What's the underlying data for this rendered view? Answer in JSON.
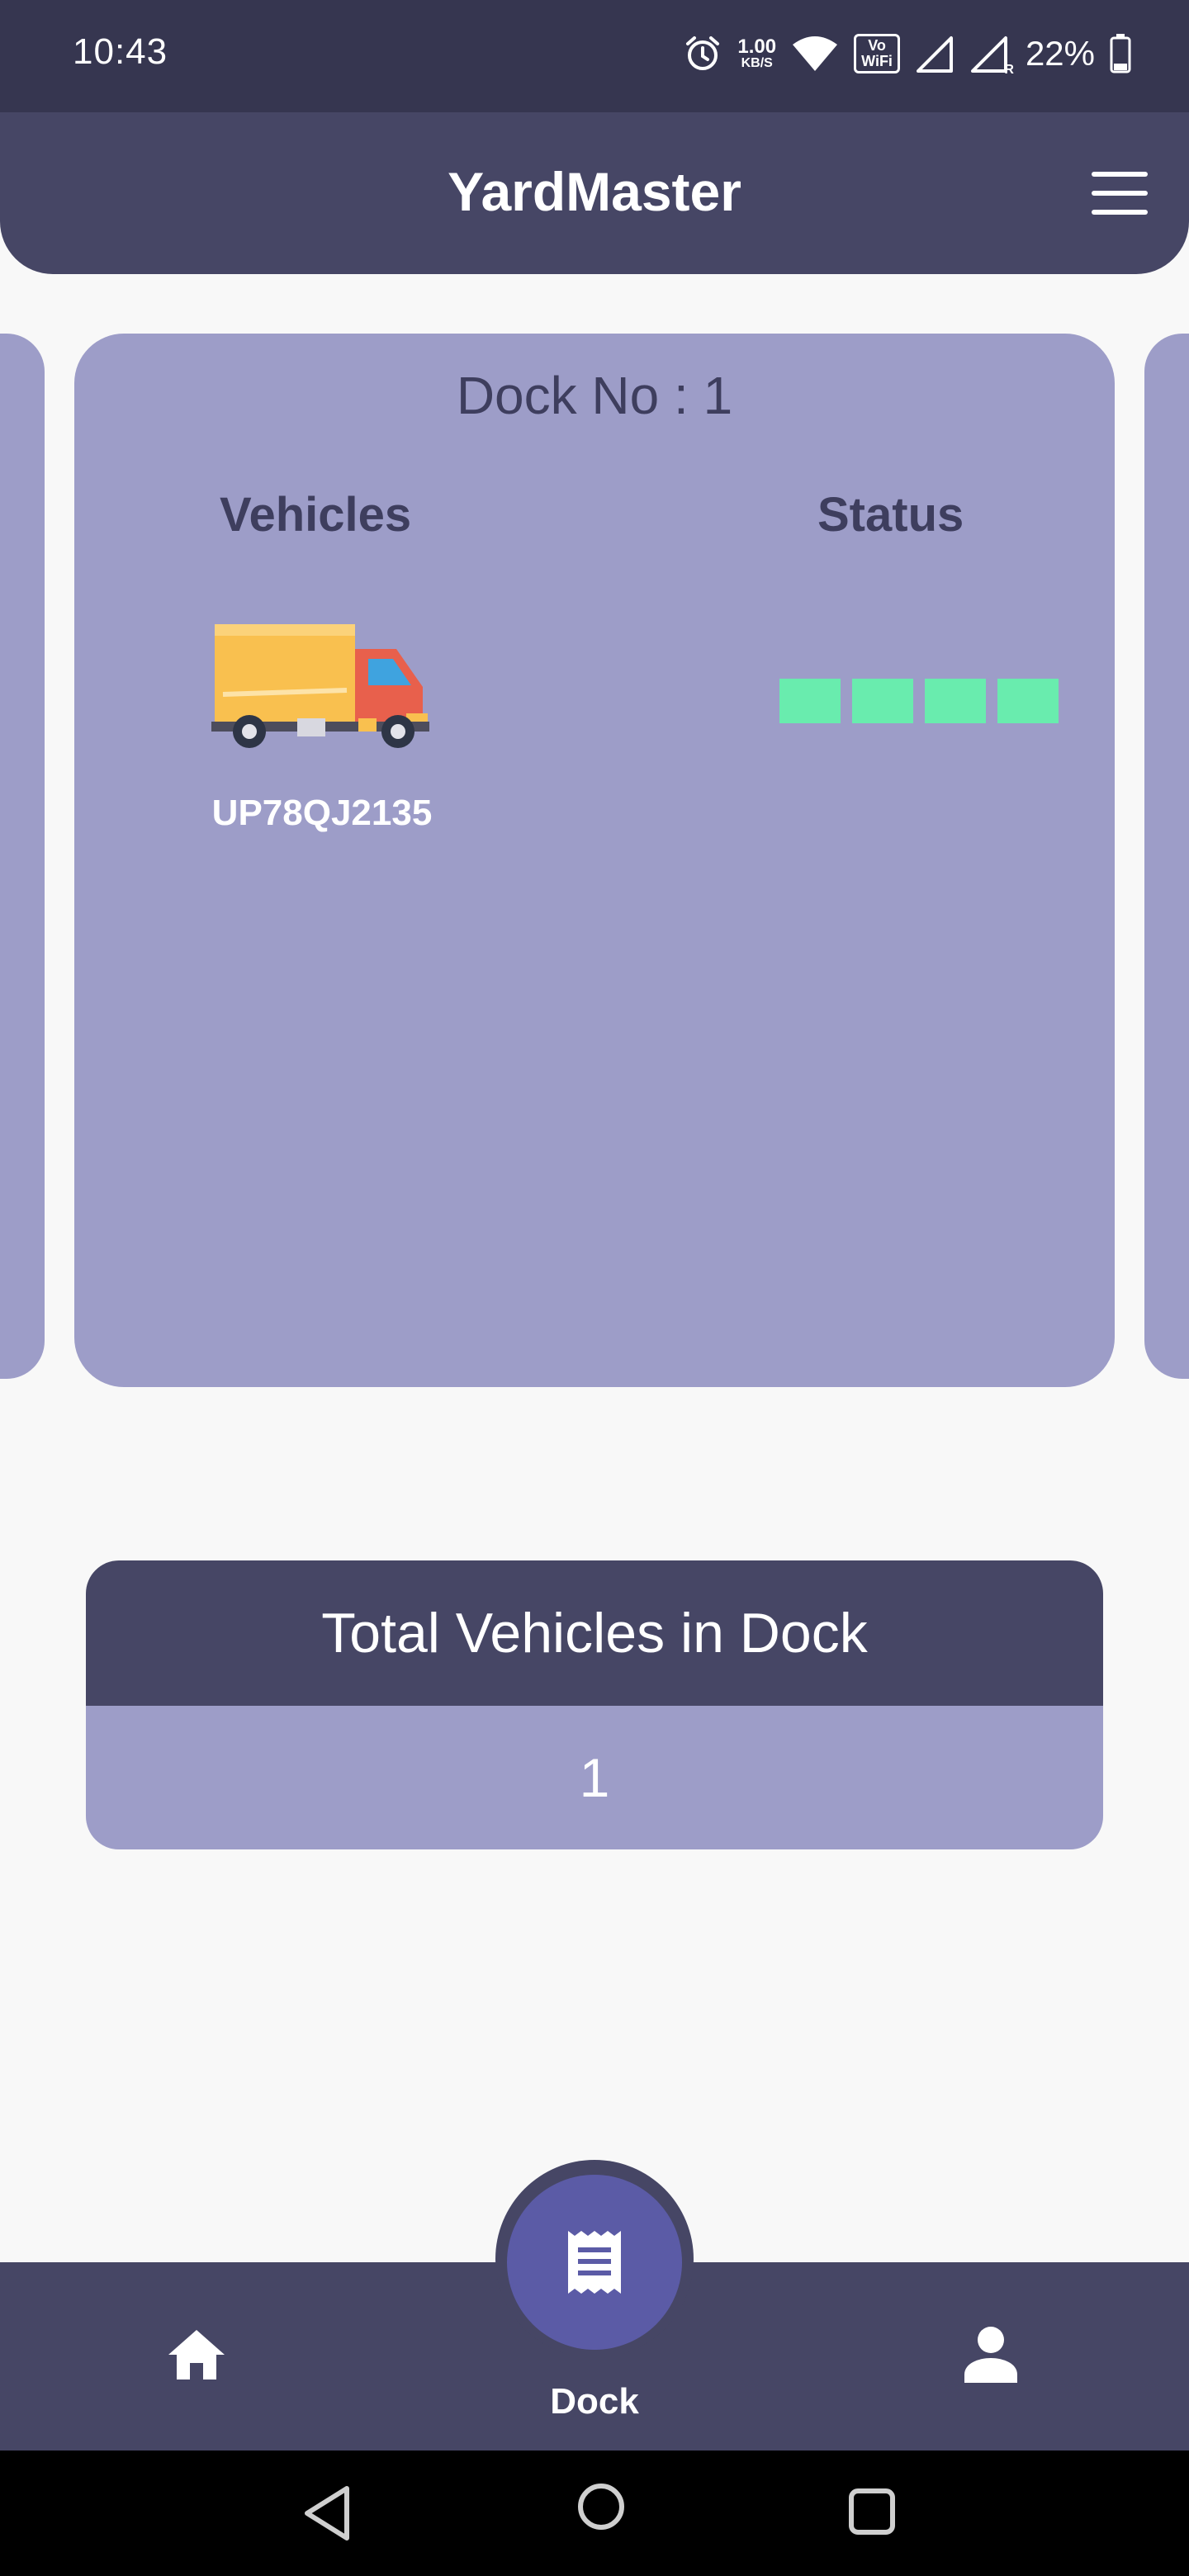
{
  "status_bar": {
    "time": "10:43",
    "net_speed_value": "1.00",
    "net_speed_unit": "KB/S",
    "volte_line1": "Vo",
    "volte_line2": "WiFi",
    "sim2_label": "R",
    "battery_percent": "22%",
    "icons": [
      "alarm-icon",
      "wifi-icon",
      "volte-wifi-icon",
      "signal-icon",
      "signal-roaming-icon",
      "battery-icon"
    ]
  },
  "app_bar": {
    "title": "YardMaster",
    "menu_icon": "hamburger-menu-icon"
  },
  "dock": {
    "title": "Dock No : 1",
    "vehicles_header": "Vehicles",
    "status_header": "Status",
    "vehicles": [
      {
        "icon": "truck-icon",
        "plate": "UP78QJ2135"
      }
    ],
    "status_segments_filled": 4,
    "status_segments_total": 4,
    "status_color": "#69ecae"
  },
  "total": {
    "label": "Total Vehicles in Dock",
    "value": "1"
  },
  "bottom_nav": {
    "home_icon": "home-icon",
    "dock_icon": "receipt-icon",
    "dock_label": "Dock",
    "profile_icon": "person-icon"
  },
  "system_nav": {
    "back": "back-icon",
    "home": "home-circle-icon",
    "recents": "recents-icon"
  },
  "colors": {
    "primary_dark": "#464665",
    "card": "#9d9dc8",
    "fab": "#5b5ba6",
    "status_green": "#69ecae",
    "truck_body": "#f9c04f",
    "truck_cab": "#e8604c"
  }
}
